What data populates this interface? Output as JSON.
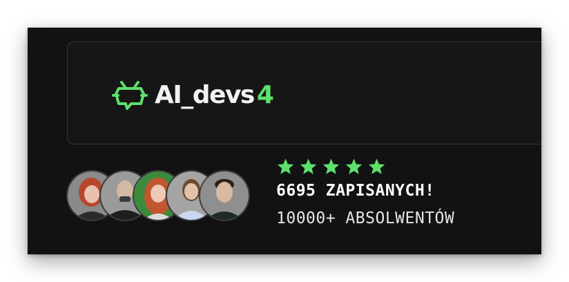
{
  "logo": {
    "name": "AI_devs",
    "version": "4",
    "icon": "ai-devs-logo-icon"
  },
  "colors": {
    "accent": "#5ee06b",
    "background": "#121212",
    "panel_border": "#343434",
    "text": "#ffffff"
  },
  "rating": {
    "stars": 5,
    "max": 5,
    "icon": "star-icon"
  },
  "stats": {
    "enrolled": "6695 ZAPISANYCH!",
    "graduates": "10000+ ABSOLWENTÓW"
  },
  "avatars": [
    {
      "name": "avatar-1",
      "icon": "person-avatar"
    },
    {
      "name": "avatar-2",
      "icon": "person-avatar"
    },
    {
      "name": "avatar-3",
      "icon": "person-avatar"
    },
    {
      "name": "avatar-4",
      "icon": "person-avatar"
    },
    {
      "name": "avatar-5",
      "icon": "person-avatar"
    }
  ]
}
